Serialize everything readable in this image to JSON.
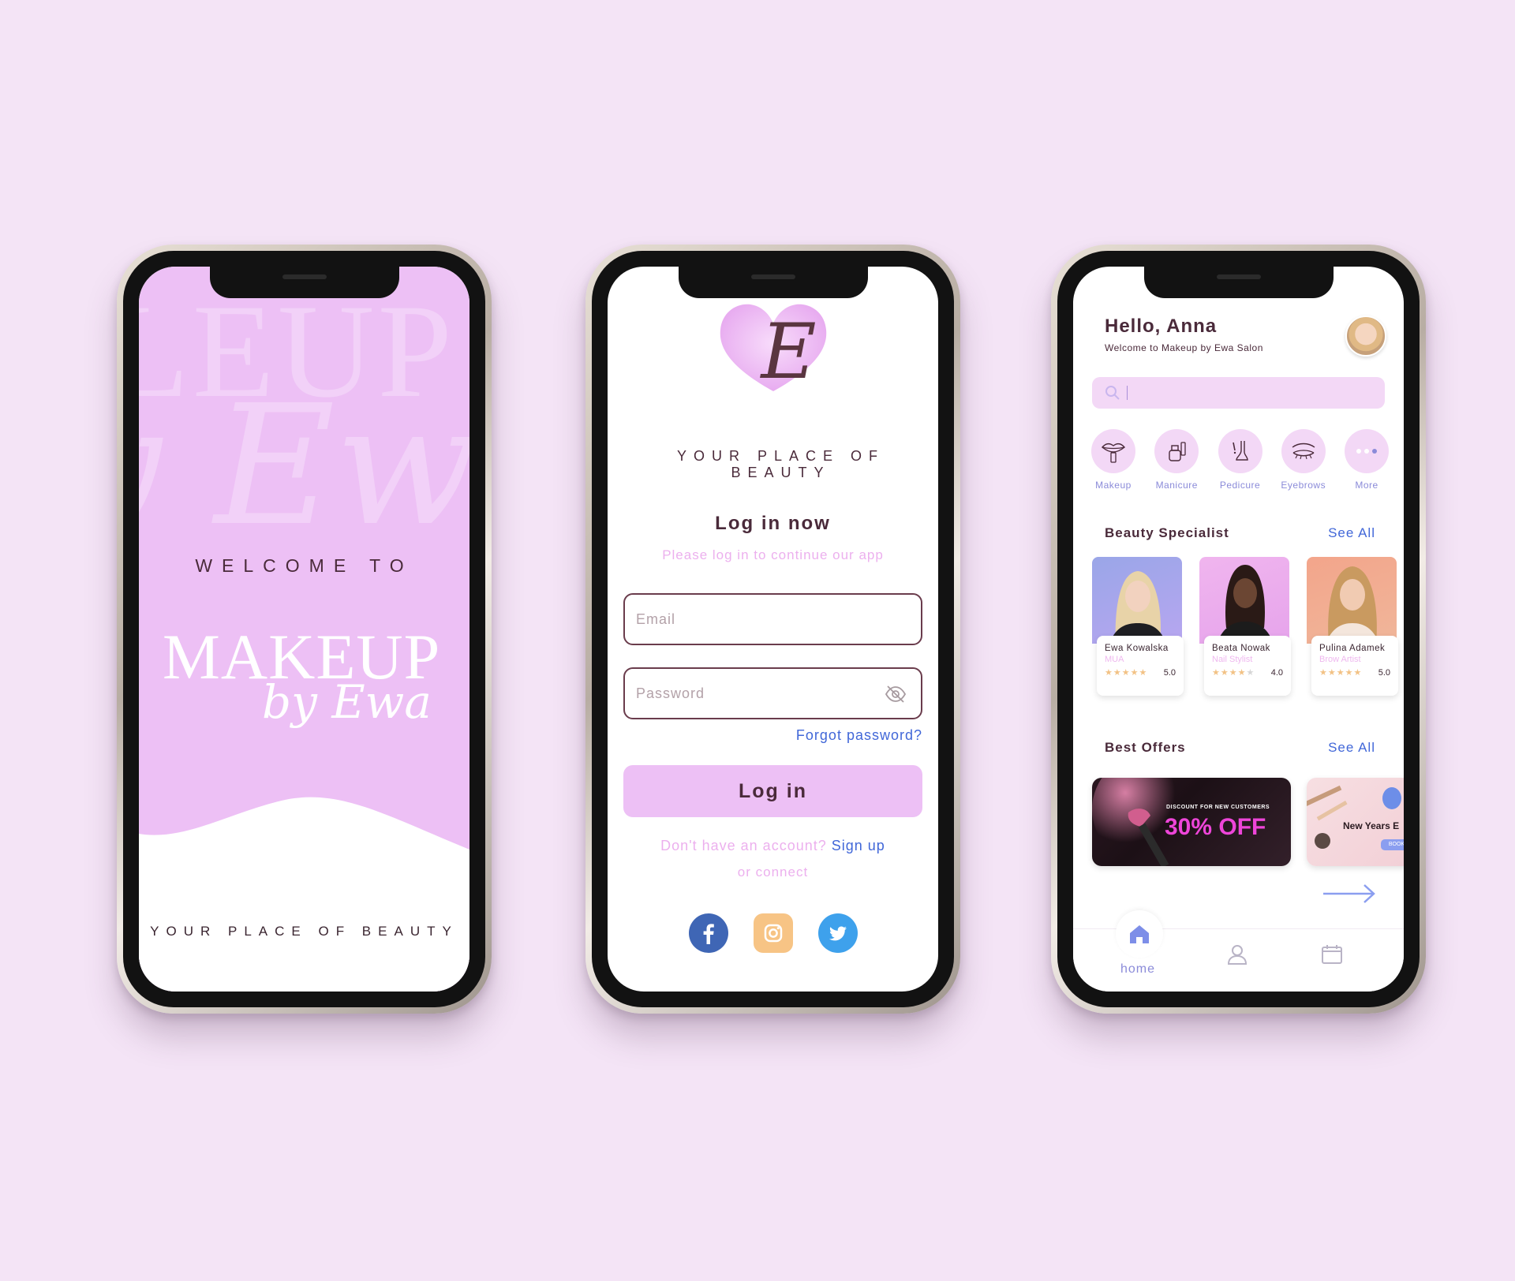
{
  "colors": {
    "background": "#f4e4f6",
    "brand_pink": "#edc0f5",
    "brand_dark": "#4a2a3a",
    "link_blue": "#4167d8",
    "accent_lavender": "#8b8bd9"
  },
  "splash": {
    "welcome": "WELCOME TO",
    "brand_main": "MAKEUP",
    "brand_script": "by Ewa",
    "tagline": "YOUR PLACE OF BEAUTY"
  },
  "login": {
    "logo_letter": "E",
    "tagline": "YOUR PLACE OF BEAUTY",
    "title": "Log in now",
    "subtitle": "Please log in to continue our app",
    "email_placeholder": "Email",
    "password_placeholder": "Password",
    "forgot": "Forgot password?",
    "button": "Log in",
    "no_account": "Don't have an account?",
    "sign_up": "Sign up",
    "or_connect": "or connect",
    "socials": [
      "facebook-icon",
      "instagram-icon",
      "twitter-icon"
    ]
  },
  "home": {
    "greeting": "Hello, Anna",
    "welcome_sub": "Welcome to Makeup by Ewa Salon",
    "search_placeholder": "",
    "categories": [
      {
        "label": "Makeup",
        "icon": "lips-icon"
      },
      {
        "label": "Manicure",
        "icon": "nail-polish-icon"
      },
      {
        "label": "Pedicure",
        "icon": "foot-icon"
      },
      {
        "label": "Eyebrows",
        "icon": "eye-lashes-icon"
      },
      {
        "label": "More",
        "icon": "more-dots-icon"
      }
    ],
    "specialists_title": "Beauty Specialist",
    "offers_title": "Best Offers",
    "see_all": "See All",
    "specialists": [
      {
        "name": "Ewa Kowalska",
        "role": "MUA",
        "rating": "5.0",
        "stars": 5
      },
      {
        "name": "Beata Nowak",
        "role": "Nail Stylist",
        "rating": "4.0",
        "stars": 4
      },
      {
        "name": "Pulina Adamek",
        "role": "Brow Artist",
        "rating": "5.0",
        "stars": 5
      }
    ],
    "offers": [
      {
        "kicker": "DISCOUNT FOR NEW CUSTOMERS",
        "headline": "30% OFF"
      },
      {
        "headline": "New Years E",
        "button": "BOOK"
      }
    ],
    "tabs": {
      "home": "home"
    }
  }
}
